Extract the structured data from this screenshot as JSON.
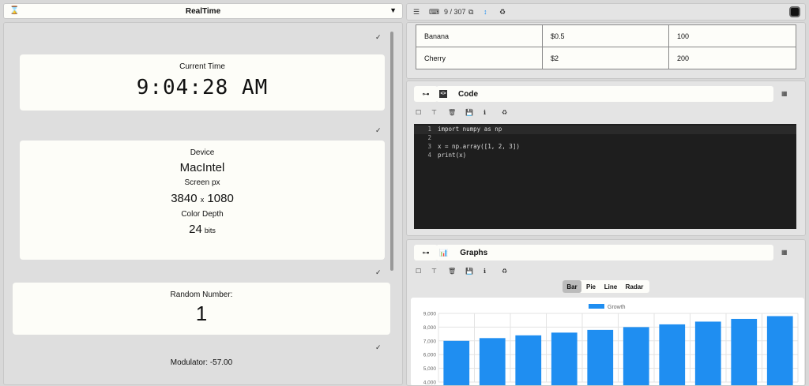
{
  "left": {
    "title": "RealTime",
    "current_time_label": "Current Time",
    "current_time": "9:04:28 AM",
    "device_label": "Device",
    "device": "MacIntel",
    "screen_label": "Screen px",
    "screen_width": "3840",
    "screen_x": "x",
    "screen_height": "1080",
    "color_depth_label": "Color Depth",
    "color_depth": "24",
    "color_depth_unit": "bits",
    "random_label": "Random Number:",
    "random_value": "1",
    "modulator": "Modulator: -57.00"
  },
  "toolbar": {
    "counter": "9 / 307"
  },
  "table": {
    "rows": [
      [
        "Banana",
        "$0.5",
        "100"
      ],
      [
        "Cherry",
        "$2",
        "200"
      ]
    ]
  },
  "code_panel": {
    "title": "Code",
    "lines": [
      {
        "n": "1",
        "text": "import numpy as np"
      },
      {
        "n": "2",
        "text": ""
      },
      {
        "n": "3",
        "text": "x = np.array([1, 2, 3])"
      },
      {
        "n": "4",
        "text": "print(x)"
      }
    ]
  },
  "graphs_panel": {
    "title": "Graphs",
    "tabs": [
      "Bar",
      "Pie",
      "Line",
      "Radar"
    ],
    "active_tab": "Bar"
  },
  "colors": {
    "bar": "#1f8ef1"
  },
  "chart_data": {
    "type": "bar",
    "series": [
      {
        "name": "Growth",
        "values": [
          7000,
          7200,
          7400,
          7600,
          7800,
          8000,
          8200,
          8400,
          8600,
          8800
        ]
      }
    ],
    "ylim": [
      4000,
      9000
    ],
    "yticks": [
      "9,000",
      "8,000",
      "7,000",
      "6,000",
      "5,000",
      "4,000"
    ],
    "grid": true,
    "legend": "top-center"
  }
}
